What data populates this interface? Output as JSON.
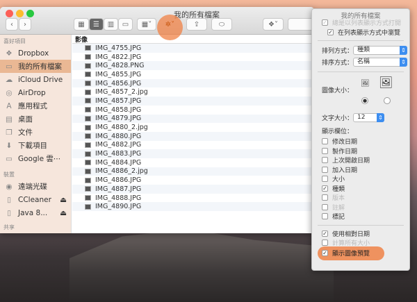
{
  "window": {
    "title": "我的所有檔案",
    "column_header": "影像"
  },
  "sidebar": {
    "favorites_header": "喜好項目",
    "favorites": [
      {
        "label": "Dropbox",
        "icon": "dropbox-icon"
      },
      {
        "label": "我的所有檔案",
        "icon": "all-files-icon",
        "selected": true
      },
      {
        "label": "iCloud Drive",
        "icon": "cloud-icon"
      },
      {
        "label": "AirDrop",
        "icon": "airdrop-icon"
      },
      {
        "label": "應用程式",
        "icon": "applications-icon"
      },
      {
        "label": "桌面",
        "icon": "desktop-icon"
      },
      {
        "label": "文件",
        "icon": "documents-icon"
      },
      {
        "label": "下載項目",
        "icon": "download-icon"
      },
      {
        "label": "Google 雲⋯",
        "icon": "folder-icon"
      }
    ],
    "devices_header": "裝置",
    "devices": [
      {
        "label": "遠端光碟",
        "icon": "disc-icon"
      },
      {
        "label": "CCleaner",
        "icon": "drive-icon",
        "eject": "⏏"
      },
      {
        "label": "Java 8...",
        "icon": "drive-icon",
        "eject": "⏏"
      }
    ],
    "shared_header": "共享"
  },
  "files": [
    "IMG_4755.JPG",
    "IMG_4822.JPG",
    "IMG_4828.PNG",
    "IMG_4855.JPG",
    "IMG_4856.JPG",
    "IMG_4857_2.jpg",
    "IMG_4857.JPG",
    "IMG_4858.JPG",
    "IMG_4879.JPG",
    "IMG_4880_2.jpg",
    "IMG_4880.JPG",
    "IMG_4882.JPG",
    "IMG_4883.JPG",
    "IMG_4884.JPG",
    "IMG_4886_2.jpg",
    "IMG_4886.JPG",
    "IMG_4887.JPG",
    "IMG_4888.JPG",
    "IMG_4890.JPG"
  ],
  "panel": {
    "title": "我的所有檔案",
    "always_open_list": "總是以列表顯示方式打開",
    "browse_in_list": "在列表顯示方式中瀏覽",
    "arrange_label": "排列方式：",
    "arrange_value": "種類",
    "sort_label": "排序方式：",
    "sort_value": "名稱",
    "icon_size_label": "圖像大小：",
    "text_size_label": "文字大小：",
    "text_size_value": "12",
    "columns_label": "顯示欄位：",
    "columns": [
      {
        "label": "修改日期",
        "checked": false
      },
      {
        "label": "製作日期",
        "checked": false
      },
      {
        "label": "上次開啟日期",
        "checked": false
      },
      {
        "label": "加入日期",
        "checked": false
      },
      {
        "label": "大小",
        "checked": false
      },
      {
        "label": "種類",
        "checked": true
      },
      {
        "label": "版本",
        "checked": false,
        "disabled": true
      },
      {
        "label": "註解",
        "checked": false,
        "disabled": true
      },
      {
        "label": "標記",
        "checked": false
      }
    ],
    "relative_dates": "使用相對日期",
    "calc_sizes": "計算所有大小",
    "show_previews": "顯示圖像預覽"
  },
  "colors": {
    "highlight": "#f0824a",
    "selection": "#eab894",
    "accent": "#3d8ef0"
  }
}
